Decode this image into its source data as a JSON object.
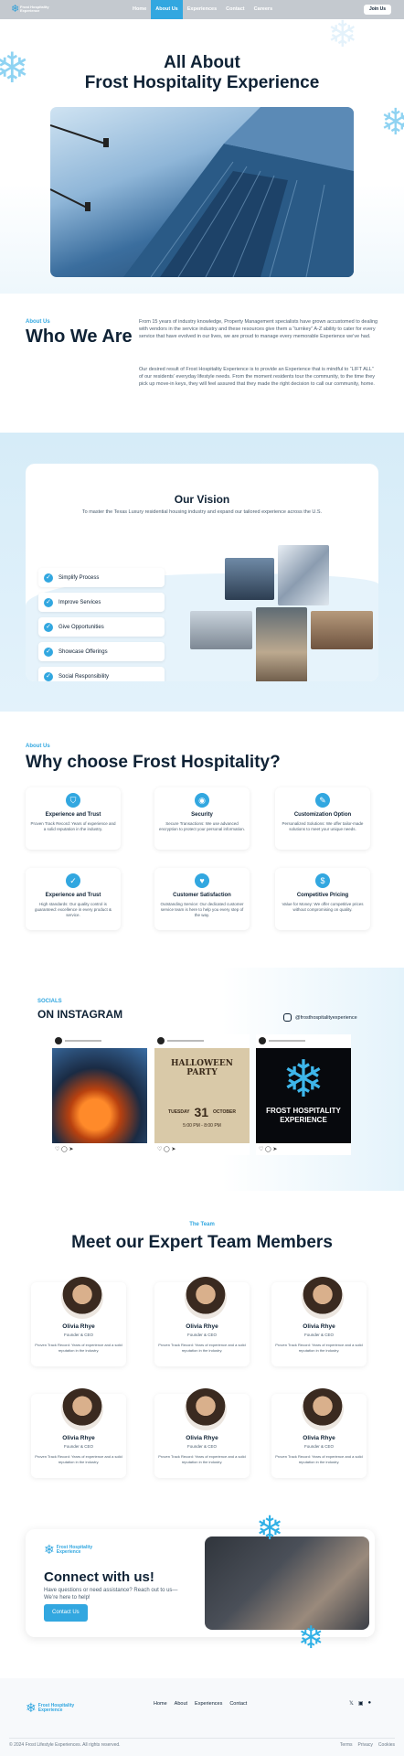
{
  "nav": {
    "logo_text": "Frost Hospitality Experience",
    "links": [
      "Home",
      "About Us",
      "Experiences",
      "Contact",
      "Careers"
    ],
    "active_index": 1,
    "join_label": "Join Us"
  },
  "hero": {
    "title_line1": "All About",
    "title_line2": "Frost Hospitality Experience"
  },
  "who": {
    "eyebrow": "About Us",
    "title": "Who We Are",
    "para1": "From 15 years of industry knowledge, Property Management specialists have grown accustomed to dealing with vendors in the service industry and these resources give them a “turnkey” A-Z ability to cater for every service that have evolved in our lives, we are proud to manage every memorable Experience we’ve had.",
    "para2": "Our desired result of Frost Hospitality Experience is to provide an Experience that is mindful to “LIFT ALL” of our residents’ everyday lifestyle needs. From the moment residents tour the community, to the time they pick up move-in keys, they will feel assured that they made the right decision to call our community, home."
  },
  "vision": {
    "title": "Our Vision",
    "subtitle": "To master the Texas Luxury residential housing industry and expand our tailored experience across the U.S.",
    "items": [
      "Simplify Process",
      "Improve Services",
      "Give Opportunities",
      "Showcase Offerings",
      "Social Responsibility"
    ]
  },
  "why": {
    "eyebrow": "About Us",
    "title": "Why choose Frost Hospitality?",
    "features": [
      {
        "icon": "shield-icon",
        "title": "Experience and Trust",
        "desc": "Proven Track Record: Years of experience and a solid reputation in the industry."
      },
      {
        "icon": "lock-icon",
        "title": "Security",
        "desc": "Secure Transactions: We use advanced encryption to protect your personal information."
      },
      {
        "icon": "tools-icon",
        "title": "Customization Option",
        "desc": "Personalized Solutions: We offer tailor-made solutions to meet your unique needs."
      },
      {
        "icon": "check-badge-icon",
        "title": "Experience and Trust",
        "desc": "High standards: Our quality control is guaranteed: excellence in every product & service."
      },
      {
        "icon": "thumbs-up-icon",
        "title": "Customer Satisfaction",
        "desc": "Outstanding Service: Our dedicated customer service team is here to help you every step of the way."
      },
      {
        "icon": "price-tag-icon",
        "title": "Competitive Pricing",
        "desc": "Value for Money: We offer competitive prices without compromising on quality."
      }
    ]
  },
  "insta": {
    "eyebrow": "SOCIALS",
    "title": "ON INSTAGRAM",
    "handle": "@frosthospitalityexperience",
    "post3_caption": "FROST HOSPITALITY EXPERIENCE",
    "post2_title": "HALLOWEEN PARTY",
    "post2_date": "31",
    "post2_day": "TUESDAY",
    "post2_month": "OCTOBER",
    "post2_time": "5:00 PM - 8:00 PM"
  },
  "team": {
    "eyebrow": "The Team",
    "title": "Meet our Expert Team Members",
    "members": [
      {
        "name": "Olivia Rhye",
        "role": "Founder & CEO",
        "desc": "Proven Track Record: Years of experience and a solid reputation in the industry."
      },
      {
        "name": "Olivia Rhye",
        "role": "Founder & CEO",
        "desc": "Proven Track Record: Years of experience and a solid reputation in the industry."
      },
      {
        "name": "Olivia Rhye",
        "role": "Founder & CEO",
        "desc": "Proven Track Record: Years of experience and a solid reputation in the industry."
      },
      {
        "name": "Olivia Rhye",
        "role": "Founder & CEO",
        "desc": "Proven Track Record: Years of experience and a solid reputation in the industry."
      },
      {
        "name": "Olivia Rhye",
        "role": "Founder & CEO",
        "desc": "Proven Track Record: Years of experience and a solid reputation in the industry."
      },
      {
        "name": "Olivia Rhye",
        "role": "Founder & CEO",
        "desc": "Proven Track Record: Years of experience and a solid reputation in the industry."
      }
    ]
  },
  "contact": {
    "logo_text": "Frost Hospitality Experience",
    "title": "Connect with us!",
    "text": "Have questions or need assistance? Reach out to us—We’re here to help!",
    "button": "Contact Us"
  },
  "footer": {
    "logo_text": "Frost Hospitality Experience",
    "links": [
      "Home",
      "About",
      "Experiences",
      "Contact"
    ],
    "copyright": "© 2024 Frost Lifestyle Experiences. All rights reserved.",
    "legal": [
      "Terms",
      "Privacy",
      "Cookies"
    ]
  },
  "colors": {
    "accent": "#32a7e0",
    "ink": "#0f2235"
  }
}
